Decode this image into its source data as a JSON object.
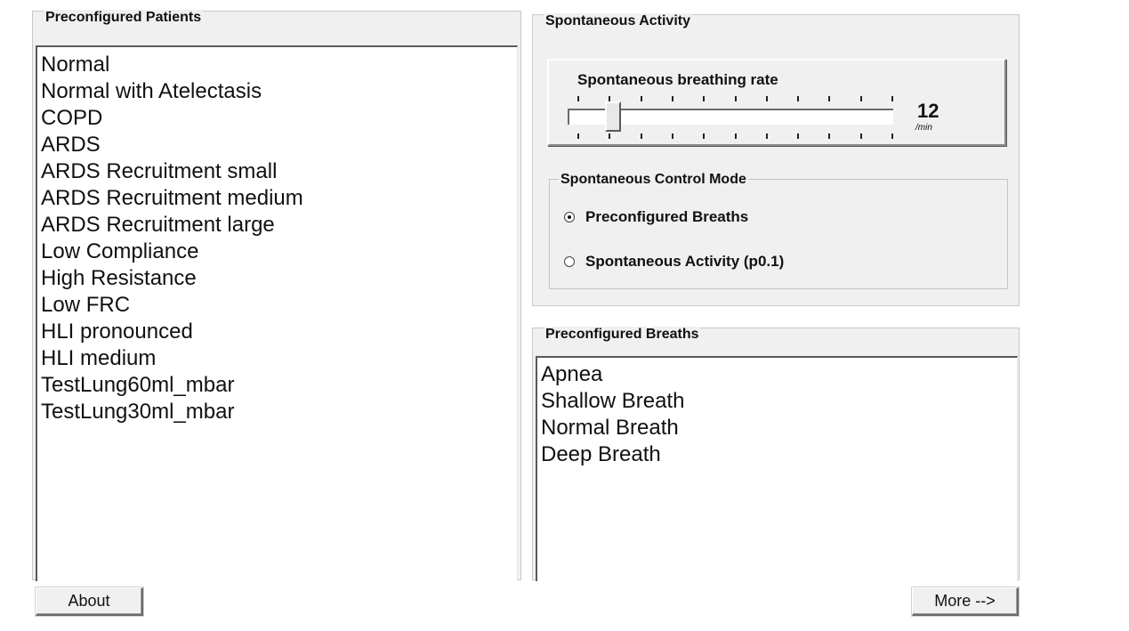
{
  "patients": {
    "title": "Preconfigured Patients",
    "items": [
      "Normal",
      "Normal with Atelectasis",
      "COPD",
      "ARDS",
      "ARDS Recruitment small",
      "ARDS Recruitment medium",
      "ARDS Recruitment large",
      "Low Compliance",
      "High Resistance",
      "Low FRC",
      "HLI pronounced",
      "HLI medium",
      "TestLung60ml_mbar",
      "TestLung30ml_mbar"
    ]
  },
  "spontaneous": {
    "title": "Spontaneous Activity",
    "rate_label": "Spontaneous breathing rate",
    "rate_value": "12",
    "rate_unit": "/min",
    "slider_fraction": 0.12,
    "mode": {
      "title": "Spontaneous Control Mode",
      "options": [
        {
          "label": "Preconfigured Breaths",
          "checked": true
        },
        {
          "label": "Spontaneous Activity (p0.1)",
          "checked": false
        }
      ]
    }
  },
  "breaths": {
    "title": "Preconfigured Breaths",
    "items": [
      "Apnea",
      "Shallow Breath",
      "Normal Breath",
      "Deep Breath"
    ]
  },
  "footer": {
    "about_label": "About",
    "more_label": "More -->"
  }
}
